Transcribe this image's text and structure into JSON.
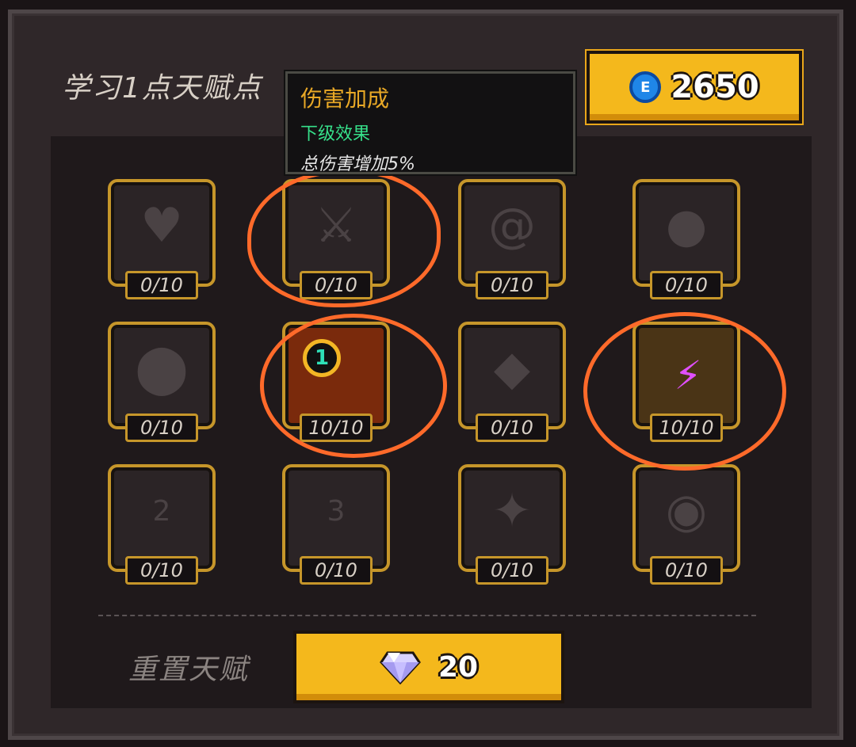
{
  "header": {
    "learn_title": "学习1点天赋点",
    "coin_amount": "2650",
    "coin_icon": "coin-icon"
  },
  "tooltip": {
    "title": "伤害加成",
    "subtitle": "下级效果",
    "description": "总伤害增加5%"
  },
  "talents": [
    {
      "icon": "heart-icon",
      "count": "0/10"
    },
    {
      "icon": "sword-icon",
      "count": "0/10"
    },
    {
      "icon": "swirl-icon",
      "count": "0/10"
    },
    {
      "icon": "drop-icon",
      "count": "0/10"
    },
    {
      "icon": "bubbles-icon",
      "count": "0/10"
    },
    {
      "icon": "level-one-icon",
      "count": "10/10",
      "badge": "1"
    },
    {
      "icon": "shield-icon",
      "count": "0/10"
    },
    {
      "icon": "lightning-icon",
      "count": "10/10"
    },
    {
      "icon": "level-two-icon",
      "count": "0/10",
      "badge": "2"
    },
    {
      "icon": "level-three-icon",
      "count": "0/10",
      "badge": "3"
    },
    {
      "icon": "sparkle-icon",
      "count": "0/10"
    },
    {
      "icon": "eye-icon",
      "count": "0/10"
    }
  ],
  "footer": {
    "reset_label": "重置天赋",
    "gem_cost": "20",
    "gem_icon": "diamond-icon"
  },
  "colors": {
    "accent_gold": "#f4b81c",
    "annotation_orange": "#ff6a2a",
    "tooltip_green": "#36e08a"
  }
}
